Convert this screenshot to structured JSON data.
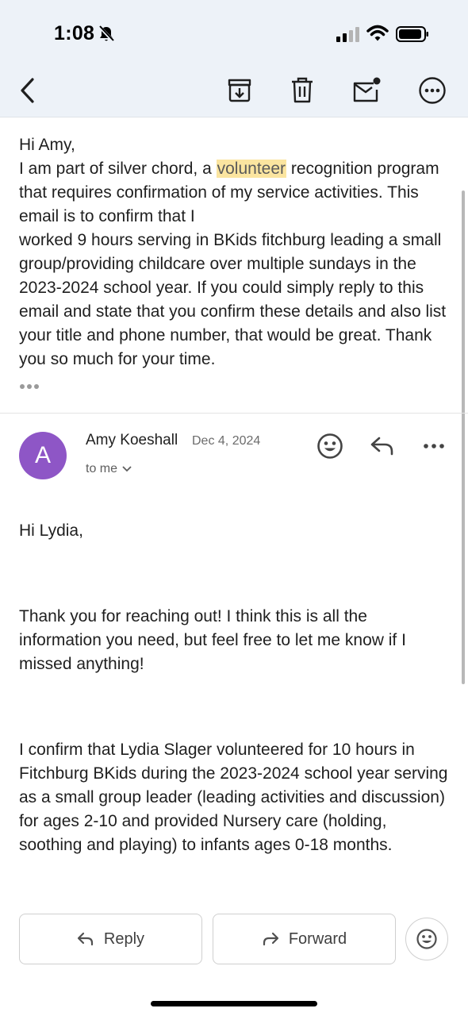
{
  "status_bar": {
    "time": "1:08"
  },
  "original_message": {
    "greeting": "Hi Amy,",
    "line_before": "I am part of silver chord, a ",
    "highlighted_word": "volunteer",
    "line_after": " recognition program that requires confirmation of my service activities. This email is to confirm that I",
    "paragraph_rest": "worked 9 hours serving in BKids fitchburg leading a small group/providing childcare over multiple sundays in the 2023-2024 school year. If you could simply reply to this email and state that you confirm these details and also list your title and phone number, that would be great. Thank you so much for your time."
  },
  "reply": {
    "avatar_letter": "A",
    "sender": "Amy Koeshall",
    "date": "Dec 4, 2024",
    "recipient": "to me",
    "paragraphs": [
      "Hi Lydia,",
      "Thank you for reaching out! I think this is all the information you need, but feel free to let me know if I missed anything!",
      "I confirm that Lydia Slager volunteered for 10 hours in Fitchburg BKids during the 2023-2024 school year serving as a small group leader (leading activities and discussion) for ages 2-10 and provided Nursery care (holding, soothing and playing) to infants ages 0-18 months."
    ]
  },
  "actions": {
    "reply_label": "Reply",
    "forward_label": "Forward"
  },
  "colors": {
    "avatar": "#8e56c6",
    "highlight": "#fbe5a0",
    "header_bg": "#edf2f8"
  }
}
